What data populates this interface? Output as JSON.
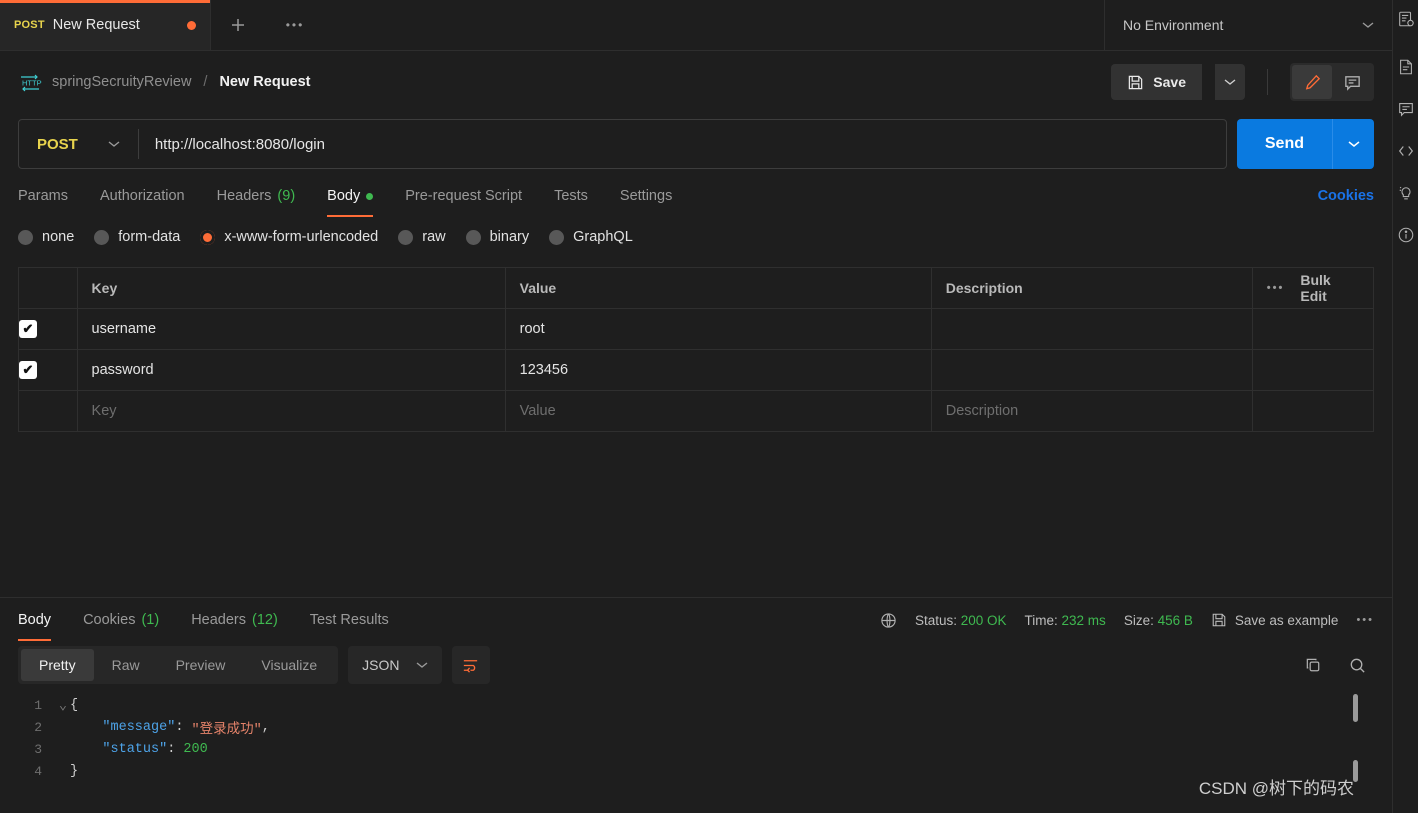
{
  "tab": {
    "method": "POST",
    "title": "New Request",
    "unsaved_dot": "unsaved-indicator",
    "add_label": "+",
    "more_label": "•••"
  },
  "environment": {
    "selected": "No Environment"
  },
  "breadcrumb": {
    "protocol_icon": "http-icon",
    "collection": "springSecruityReview",
    "separator": "/",
    "current": "New Request"
  },
  "actions": {
    "save_label": "Save",
    "save_caret": "chevron-down-icon",
    "edit_icon": "pencil-icon",
    "comment_icon": "comment-icon"
  },
  "request": {
    "method": "POST",
    "url": "http://localhost:8080/login",
    "send_label": "Send",
    "tabs": [
      {
        "label": "Params",
        "active": false
      },
      {
        "label": "Authorization",
        "active": false
      },
      {
        "label": "Headers",
        "count": "(9)",
        "active": false
      },
      {
        "label": "Body",
        "active": true,
        "dot": true
      },
      {
        "label": "Pre-request Script",
        "active": false
      },
      {
        "label": "Tests",
        "active": false
      },
      {
        "label": "Settings",
        "active": false
      }
    ],
    "cookies_link": "Cookies",
    "body_types": [
      {
        "label": "none",
        "selected": false
      },
      {
        "label": "form-data",
        "selected": false
      },
      {
        "label": "x-www-form-urlencoded",
        "selected": true
      },
      {
        "label": "raw",
        "selected": false
      },
      {
        "label": "binary",
        "selected": false
      },
      {
        "label": "GraphQL",
        "selected": false
      }
    ]
  },
  "table": {
    "headers": {
      "key": "Key",
      "value": "Value",
      "description": "Description"
    },
    "bulk_edit": "Bulk Edit",
    "more": "•••",
    "rows": [
      {
        "checked": true,
        "key": "username",
        "value": "root",
        "description": ""
      },
      {
        "checked": true,
        "key": "password",
        "value": "123456",
        "description": ""
      }
    ],
    "placeholder_row": {
      "key": "Key",
      "value": "Value",
      "description": "Description"
    }
  },
  "response": {
    "tabs": [
      {
        "label": "Body",
        "active": true
      },
      {
        "label": "Cookies",
        "count": "(1)",
        "active": false
      },
      {
        "label": "Headers",
        "count": "(12)",
        "active": false
      },
      {
        "label": "Test Results",
        "active": false
      }
    ],
    "status_label": "Status:",
    "status_value": "200 OK",
    "time_label": "Time:",
    "time_value": "232 ms",
    "size_label": "Size:",
    "size_value": "456 B",
    "save_example": "Save as example",
    "more": "•••",
    "view_modes": [
      {
        "label": "Pretty",
        "active": true
      },
      {
        "label": "Raw",
        "active": false
      },
      {
        "label": "Preview",
        "active": false
      },
      {
        "label": "Visualize",
        "active": false
      }
    ],
    "format": "JSON",
    "wrap_icon": "wrap-lines-icon",
    "copy_icon": "copy-icon",
    "search_icon": "search-icon",
    "body_lines": [
      {
        "num": "1",
        "parts": [
          {
            "t": "{",
            "c": "brace"
          }
        ]
      },
      {
        "num": "2",
        "parts": [
          {
            "t": "    ",
            "c": "p"
          },
          {
            "t": "\"message\"",
            "c": "k"
          },
          {
            "t": ": ",
            "c": "p"
          },
          {
            "t": "\"登录成功\"",
            "c": "s"
          },
          {
            "t": ",",
            "c": "p"
          }
        ]
      },
      {
        "num": "3",
        "parts": [
          {
            "t": "    ",
            "c": "p"
          },
          {
            "t": "\"status\"",
            "c": "k"
          },
          {
            "t": ": ",
            "c": "p"
          },
          {
            "t": "200",
            "c": "n"
          }
        ]
      },
      {
        "num": "4",
        "parts": [
          {
            "t": "}",
            "c": "brace"
          }
        ]
      }
    ]
  },
  "rail_icons": [
    "environment-quick-look-icon",
    "documentation-icon",
    "comments-icon",
    "code-snippet-icon",
    "info-bulb-icon",
    "info-circle-icon"
  ],
  "watermark": "CSDN @树下的码农",
  "colors": {
    "accent": "#ff6c37",
    "send": "#0a7ae0",
    "method": "#e8d44d",
    "success": "#3fb950",
    "link": "#1a73e8",
    "background": "#1e1e1e"
  }
}
